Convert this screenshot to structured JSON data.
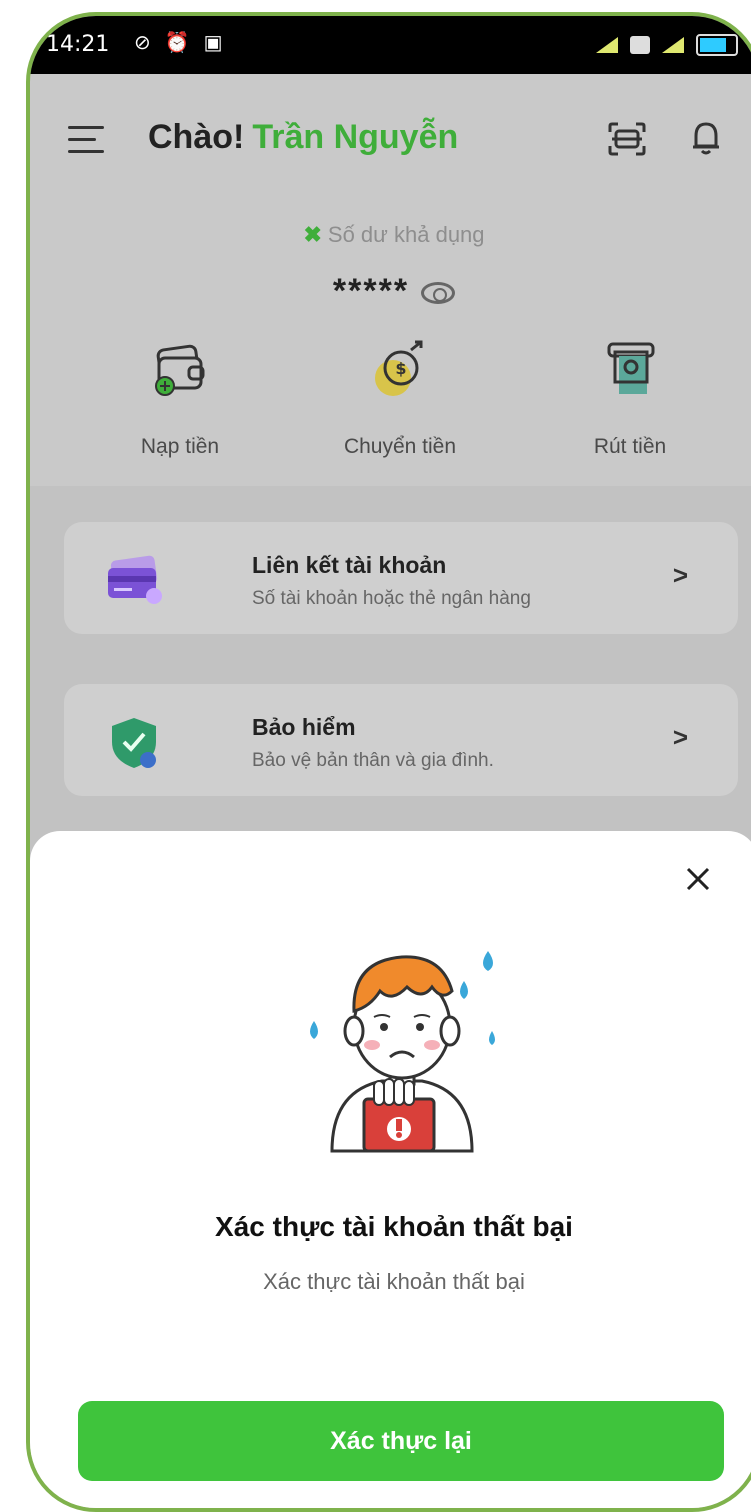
{
  "status_bar": {
    "time": "14:21"
  },
  "header": {
    "greeting": "Chào!",
    "user_name": "Trần Nguyễn"
  },
  "balance": {
    "label": "Số dư khả dụng",
    "value": "*****"
  },
  "actions": [
    {
      "label": "Nạp tiền",
      "icon": "wallet-plus-icon"
    },
    {
      "label": "Chuyển tiền",
      "icon": "money-transfer-icon"
    },
    {
      "label": "Rút tiền",
      "icon": "atm-withdraw-icon"
    }
  ],
  "cards": [
    {
      "title": "Liên kết tài khoản",
      "subtitle": "Số tài khoản hoặc thẻ ngân hàng",
      "icon": "card-icon"
    },
    {
      "title": "Bảo hiểm",
      "subtitle": "Bảo vệ bản thân và gia đình.",
      "icon": "shield-icon"
    }
  ],
  "dialog": {
    "title": "Xác thực tài khoản thất bại",
    "message": "Xác thực tài khoản thất bại",
    "button_label": "Xác thực lại"
  },
  "colors": {
    "brand_green": "#3fae3a",
    "button_green": "#3fc43c",
    "card_purple": "#7b52d6",
    "shield_green": "#2f9a6a",
    "alert_red": "#d9403a"
  }
}
